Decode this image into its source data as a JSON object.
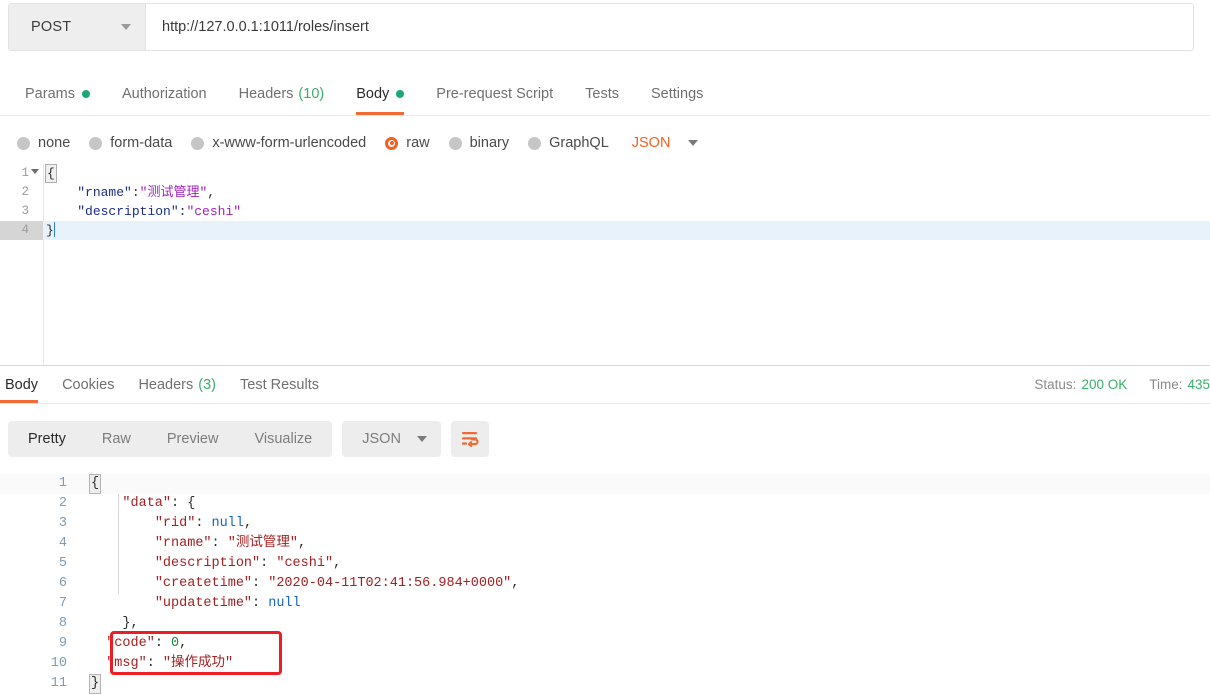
{
  "request": {
    "method": "POST",
    "url": "http://127.0.0.1:1011/roles/insert",
    "tabs": [
      {
        "label": "Params",
        "badge_dot": true
      },
      {
        "label": "Authorization",
        "badge_dot": false
      },
      {
        "label": "Headers",
        "count": "(10)"
      },
      {
        "label": "Body",
        "badge_dot": true,
        "active": true
      },
      {
        "label": "Pre-request Script"
      },
      {
        "label": "Tests"
      },
      {
        "label": "Settings"
      }
    ],
    "body_types": [
      {
        "label": "none",
        "selected": false
      },
      {
        "label": "form-data",
        "selected": false
      },
      {
        "label": "x-www-form-urlencoded",
        "selected": false
      },
      {
        "label": "raw",
        "selected": true
      },
      {
        "label": "binary",
        "selected": false
      },
      {
        "label": "GraphQL",
        "selected": false
      }
    ],
    "raw_format": "JSON",
    "editor": {
      "lines": [
        {
          "no": "1",
          "foldable": true,
          "punct_open": "{"
        },
        {
          "no": "2",
          "key": "\"rname\"",
          "colon": ":",
          "value": "\"测试管理\"",
          "comma": ","
        },
        {
          "no": "3",
          "key": "\"description\"",
          "colon": ":",
          "value": "\"ceshi\"",
          "comma": ""
        },
        {
          "no": "4",
          "punct_close": "}",
          "highlighted": true
        }
      ]
    }
  },
  "response": {
    "tabs": [
      {
        "label": "Body",
        "active": true
      },
      {
        "label": "Cookies"
      },
      {
        "label": "Headers",
        "count": "(3)"
      },
      {
        "label": "Test Results"
      }
    ],
    "status_label": "Status:",
    "status_value": "200 OK",
    "time_label": "Time:",
    "time_value": "435",
    "view_modes": [
      {
        "label": "Pretty",
        "active": true
      },
      {
        "label": "Raw",
        "active": false
      },
      {
        "label": "Preview",
        "active": false
      },
      {
        "label": "Visualize",
        "active": false
      }
    ],
    "format": "JSON",
    "wrap_icon": "word-wrap-icon",
    "body_lines": [
      {
        "no": "1",
        "text": "{"
      },
      {
        "no": "2",
        "indent": 4,
        "key": "\"data\"",
        "sep": ": ",
        "punct": "{"
      },
      {
        "no": "3",
        "indent": 8,
        "key": "\"rid\"",
        "sep": ": ",
        "null": "null",
        "comma": ","
      },
      {
        "no": "4",
        "indent": 8,
        "key": "\"rname\"",
        "sep": ": ",
        "string": "\"测试管理\"",
        "comma": ","
      },
      {
        "no": "5",
        "indent": 8,
        "key": "\"description\"",
        "sep": ": ",
        "string": "\"ceshi\"",
        "comma": ","
      },
      {
        "no": "6",
        "indent": 8,
        "key": "\"createtime\"",
        "sep": ": ",
        "string": "\"2020-04-11T02:41:56.984+0000\"",
        "comma": ","
      },
      {
        "no": "7",
        "indent": 8,
        "key": "\"updatetime\"",
        "sep": ": ",
        "null": "null"
      },
      {
        "no": "8",
        "indent": 4,
        "punct": "},"
      },
      {
        "no": "9",
        "indent": 2,
        "key": "\"code\"",
        "sep": ": ",
        "number": "0",
        "comma": ","
      },
      {
        "no": "10",
        "indent": 2,
        "key": "\"msg\"",
        "sep": ": ",
        "string": "\"操作成功\""
      },
      {
        "no": "11",
        "text": "}"
      }
    ]
  },
  "annotation": {
    "type": "red-rectangle-highlight",
    "color": "#ee1d24",
    "covers_lines": "9-10"
  },
  "colors": {
    "accent_orange": "#ef6b33",
    "status_green": "#3aae6a",
    "dot_green": "#19a974",
    "annotation_red": "#ee1d24",
    "req_key": "#1b2d8a",
    "req_value": "#a020c0",
    "res_key": "#a52020",
    "res_null": "#1565c0",
    "res_number": "#1a8a3a"
  }
}
